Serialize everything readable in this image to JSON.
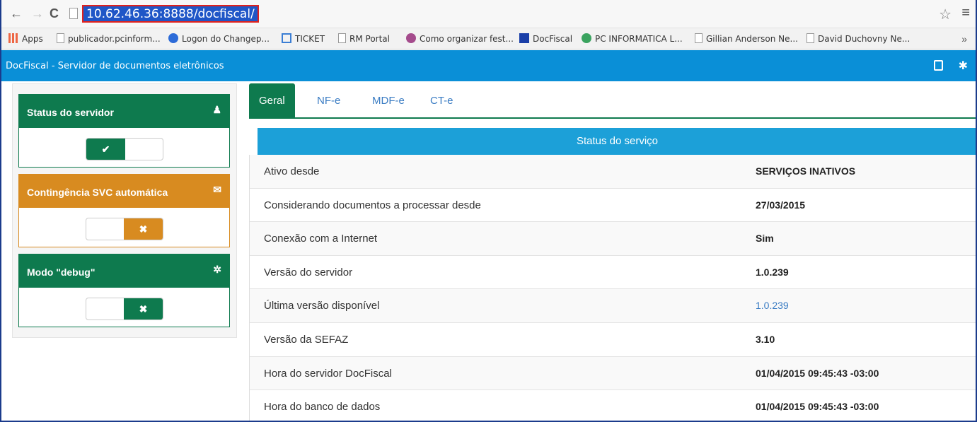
{
  "browser": {
    "url": "10.62.46.36:8888/docfiscal/",
    "bookmarks": [
      {
        "label": "Apps",
        "icon": "apps-icon"
      },
      {
        "label": "publicador.pcinform...",
        "icon": "page-icon"
      },
      {
        "label": "Logon do Changep...",
        "icon": "google-icon"
      },
      {
        "label": "TICKET",
        "icon": "ticket-icon"
      },
      {
        "label": "RM Portal",
        "icon": "page-icon"
      },
      {
        "label": "Como organizar fest...",
        "icon": "site-icon"
      },
      {
        "label": "DocFiscal",
        "icon": "docfiscal-icon"
      },
      {
        "label": "PC INFORMATICA L...",
        "icon": "pc-icon"
      },
      {
        "label": "Gillian Anderson Ne...",
        "icon": "page-icon"
      },
      {
        "label": "David Duchovny Ne...",
        "icon": "page-icon"
      }
    ],
    "more": "»"
  },
  "app": {
    "title": "DocFiscal - Servidor de documentos eletrônicos"
  },
  "sidebar": {
    "boxes": [
      {
        "title": "Status do servidor",
        "icon": "user-icon",
        "state": "on",
        "knob": "✔"
      },
      {
        "title": "Contingência SVC automática",
        "icon": "envelope-icon",
        "state": "off",
        "knob": "✖"
      },
      {
        "title": "Modo \"debug\"",
        "icon": "bug-icon",
        "state": "off",
        "knob": "✖"
      }
    ]
  },
  "tabs": [
    "Geral",
    "NF-e",
    "MDF-e",
    "CT-e"
  ],
  "service": {
    "header": "Status do serviço",
    "rows": [
      {
        "label": "Ativo desde",
        "value": "SERVIÇOS INATIVOS"
      },
      {
        "label": "Considerando documentos a processar desde",
        "value": "27/03/2015"
      },
      {
        "label": "Conexão com a Internet",
        "value": "Sim"
      },
      {
        "label": "Versão do servidor",
        "value": "1.0.239"
      },
      {
        "label": "Última versão disponível",
        "value": "1.0.239"
      },
      {
        "label": "Versão da SEFAZ",
        "value": "3.10"
      },
      {
        "label": "Hora do servidor DocFiscal",
        "value": "01/04/2015 09:45:43 -03:00"
      },
      {
        "label": "Hora do banco de dados",
        "value": "01/04/2015 09:45:43 -03:00"
      }
    ]
  },
  "colors": {
    "header_blue": "#0a8fd7",
    "green": "#0e7a4e",
    "orange": "#d88b20",
    "service_blue": "#1ca0d8",
    "link": "#3a7cc3"
  }
}
